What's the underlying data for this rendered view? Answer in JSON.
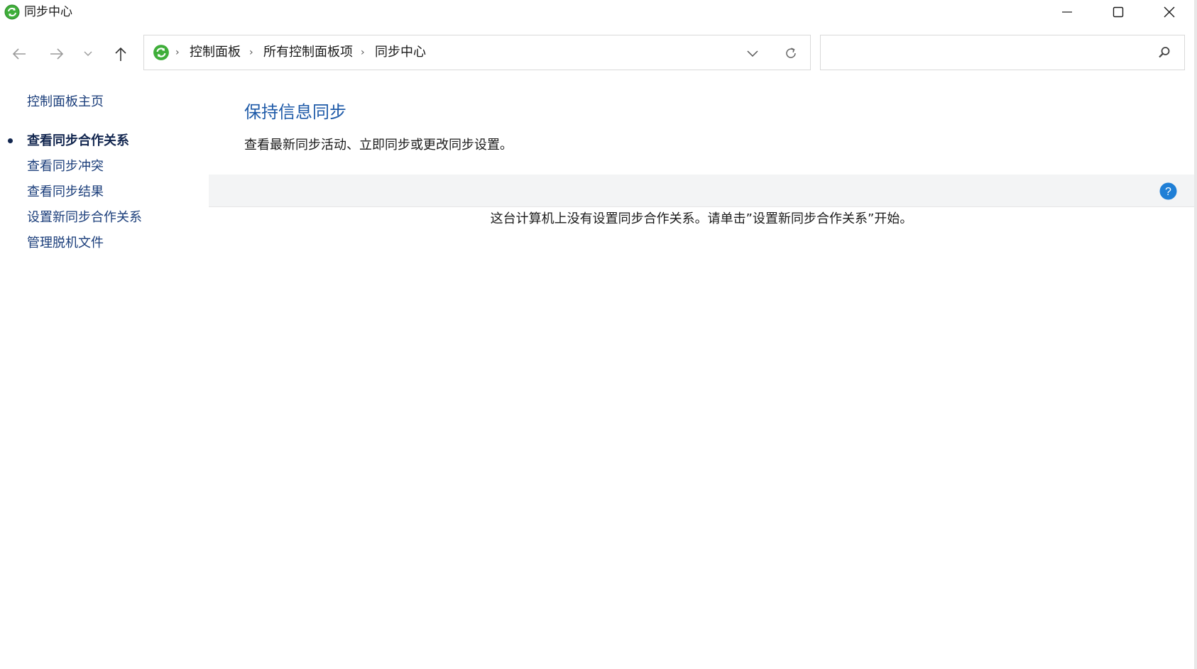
{
  "window": {
    "title": "同步中心",
    "controls": {
      "minimize": "minimize",
      "maximize": "maximize",
      "close": "close"
    }
  },
  "nav": {
    "back": "back-arrow",
    "forward": "forward-arrow",
    "recent": "chevron-down",
    "up": "up-arrow"
  },
  "address": {
    "crumbs": [
      "控制面板",
      "所有控制面板项",
      "同步中心"
    ],
    "separator": "›"
  },
  "search": {
    "placeholder": ""
  },
  "sidebar": {
    "home": "控制面板主页",
    "items": [
      {
        "label": "查看同步合作关系",
        "active": true
      },
      {
        "label": "查看同步冲突",
        "active": false
      },
      {
        "label": "查看同步结果",
        "active": false
      },
      {
        "label": "设置新同步合作关系",
        "active": false
      },
      {
        "label": "管理脱机文件",
        "active": false
      }
    ]
  },
  "main": {
    "title": "保持信息同步",
    "description": "查看最新同步活动、立即同步或更改同步设置。",
    "empty_message": "这台计算机上没有设置同步合作关系。请单击”设置新同步合作关系”开始。"
  },
  "colors": {
    "accent": "#1e5aa8",
    "link": "#1a3d7a",
    "sync_green": "#3fae3a"
  }
}
